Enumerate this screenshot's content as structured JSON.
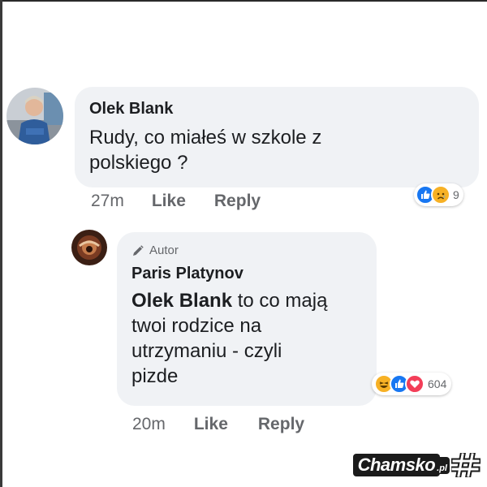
{
  "comments": [
    {
      "author": "Olek Blank",
      "text_lines": [
        "Rudy, co miałeś w szkole z",
        "polskiego ?"
      ],
      "time": "27m",
      "like_label": "Like",
      "reply_label": "Reply",
      "reactions": {
        "icons": [
          "like-icon",
          "sad-icon"
        ],
        "count": "9"
      }
    },
    {
      "badge": "Autor",
      "author": "Paris Platynov",
      "mention": "Olek Blank",
      "text_first_rest": " to co mają",
      "text_lines": [
        "twoi rodzice na",
        "utrzymaniu - czyli",
        "pizde"
      ],
      "time": "20m",
      "like_label": "Like",
      "reply_label": "Reply",
      "reactions": {
        "icons": [
          "haha-icon",
          "like-icon",
          "love-icon"
        ],
        "count": "604"
      }
    }
  ],
  "watermark": {
    "text": "Chamsko",
    "suffix": ".pl"
  },
  "colors": {
    "bubble": "#f0f2f5",
    "like_blue": "#1877f2",
    "love_red": "#f33e58",
    "reaction_yellow": "#f7b125",
    "meta_gray": "#65676b"
  }
}
